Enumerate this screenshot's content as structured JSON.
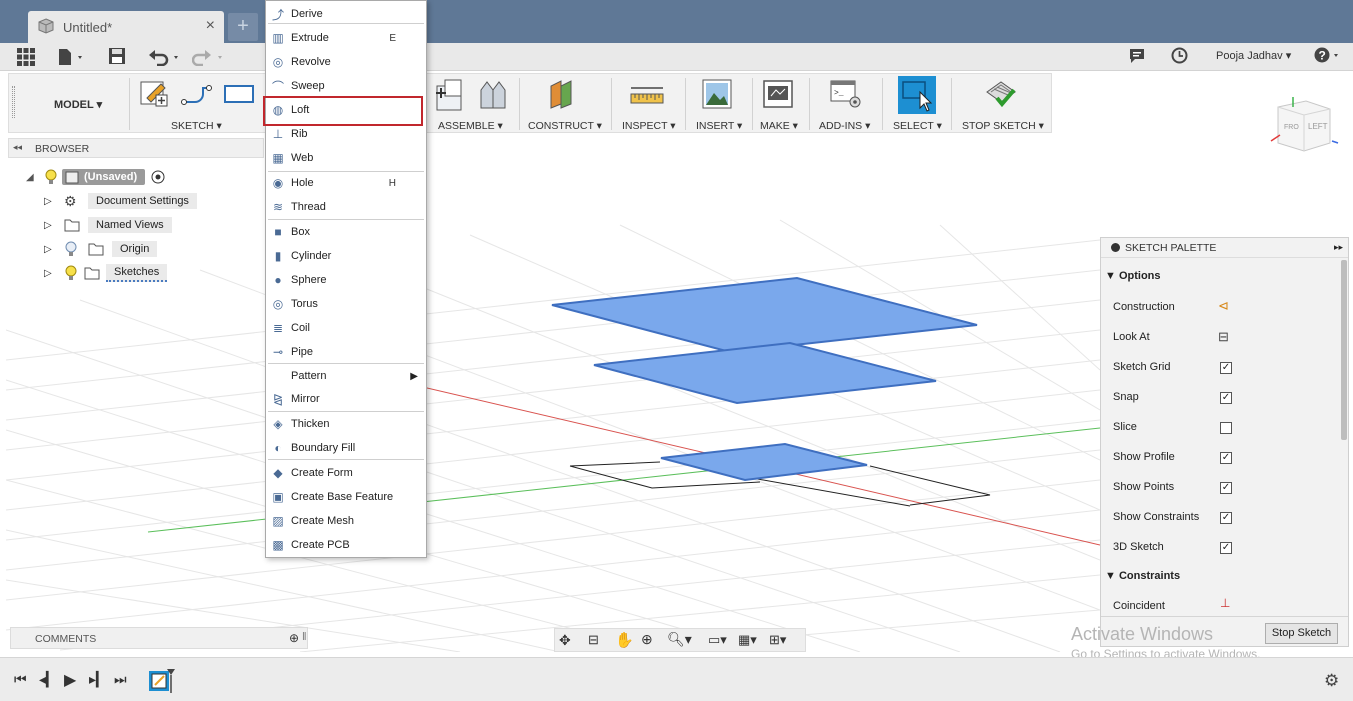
{
  "document": {
    "title": "Untitled*",
    "close": "×",
    "new_tab": "+"
  },
  "header": {
    "user": "Pooja Jadhav ▾"
  },
  "toolbar": {
    "workspace": "MODEL ▾",
    "groups": [
      "SKETCH ▾",
      "ASSEMBLE ▾",
      "CONSTRUCT ▾",
      "INSPECT ▾",
      "INSERT ▾",
      "MAKE ▾",
      "ADD-INS ▾",
      "SELECT ▾",
      "STOP SKETCH ▾"
    ]
  },
  "browser": {
    "title": "BROWSER",
    "root": "(Unsaved)",
    "items": [
      "Document Settings",
      "Named Views",
      "Origin",
      "Sketches"
    ]
  },
  "comments": {
    "label": "COMMENTS"
  },
  "create_menu": {
    "items": [
      {
        "label": "Derive",
        "icon": "derive-icon"
      },
      {
        "label": "Extrude",
        "shortcut": "E",
        "icon": "extrude-icon"
      },
      {
        "label": "Revolve",
        "icon": "revolve-icon"
      },
      {
        "label": "Sweep",
        "icon": "sweep-icon"
      },
      {
        "label": "Loft",
        "icon": "loft-icon"
      },
      {
        "label": "Rib",
        "icon": "rib-icon"
      },
      {
        "label": "Web",
        "icon": "web-icon"
      },
      {
        "label": "Hole",
        "shortcut": "H",
        "icon": "hole-icon"
      },
      {
        "label": "Thread",
        "icon": "thread-icon"
      },
      {
        "label": "Box",
        "icon": "box-icon"
      },
      {
        "label": "Cylinder",
        "icon": "cylinder-icon"
      },
      {
        "label": "Sphere",
        "icon": "sphere-icon"
      },
      {
        "label": "Torus",
        "icon": "torus-icon"
      },
      {
        "label": "Coil",
        "icon": "coil-icon"
      },
      {
        "label": "Pipe",
        "icon": "pipe-icon"
      },
      {
        "label": "Pattern",
        "icon": "pattern-icon"
      },
      {
        "label": "Mirror",
        "icon": "mirror-icon"
      },
      {
        "label": "Thicken",
        "icon": "thicken-icon"
      },
      {
        "label": "Boundary Fill",
        "icon": "boundary-fill-icon"
      },
      {
        "label": "Create Form",
        "icon": "create-form-icon"
      },
      {
        "label": "Create Base Feature",
        "icon": "create-base-feature-icon"
      },
      {
        "label": "Create Mesh",
        "icon": "create-mesh-icon"
      },
      {
        "label": "Create PCB",
        "icon": "create-pcb-icon"
      }
    ]
  },
  "palette": {
    "title": "SKETCH PALETTE",
    "options_label": "Options",
    "constraints_label": "Constraints",
    "options": [
      {
        "label": "Construction"
      },
      {
        "label": "Look At"
      },
      {
        "label": "Sketch Grid",
        "checked": true
      },
      {
        "label": "Snap",
        "checked": true
      },
      {
        "label": "Slice",
        "checked": false
      },
      {
        "label": "Show Profile",
        "checked": true
      },
      {
        "label": "Show Points",
        "checked": true
      },
      {
        "label": "Show Constraints",
        "checked": true
      },
      {
        "label": "3D Sketch",
        "checked": true
      }
    ],
    "constraints": [
      {
        "label": "Coincident"
      }
    ],
    "stop_button": "Stop Sketch"
  },
  "watermark": {
    "line1": "Activate Windows",
    "line2": "Go to Settings to activate Windows."
  },
  "viewcube": {
    "left": "LEFT"
  },
  "colors": {
    "titlebar": "#5f7896",
    "sketch_fill": "#7aa8ec",
    "highlight": "#c1272d",
    "select_button": "#1d8fd2"
  }
}
